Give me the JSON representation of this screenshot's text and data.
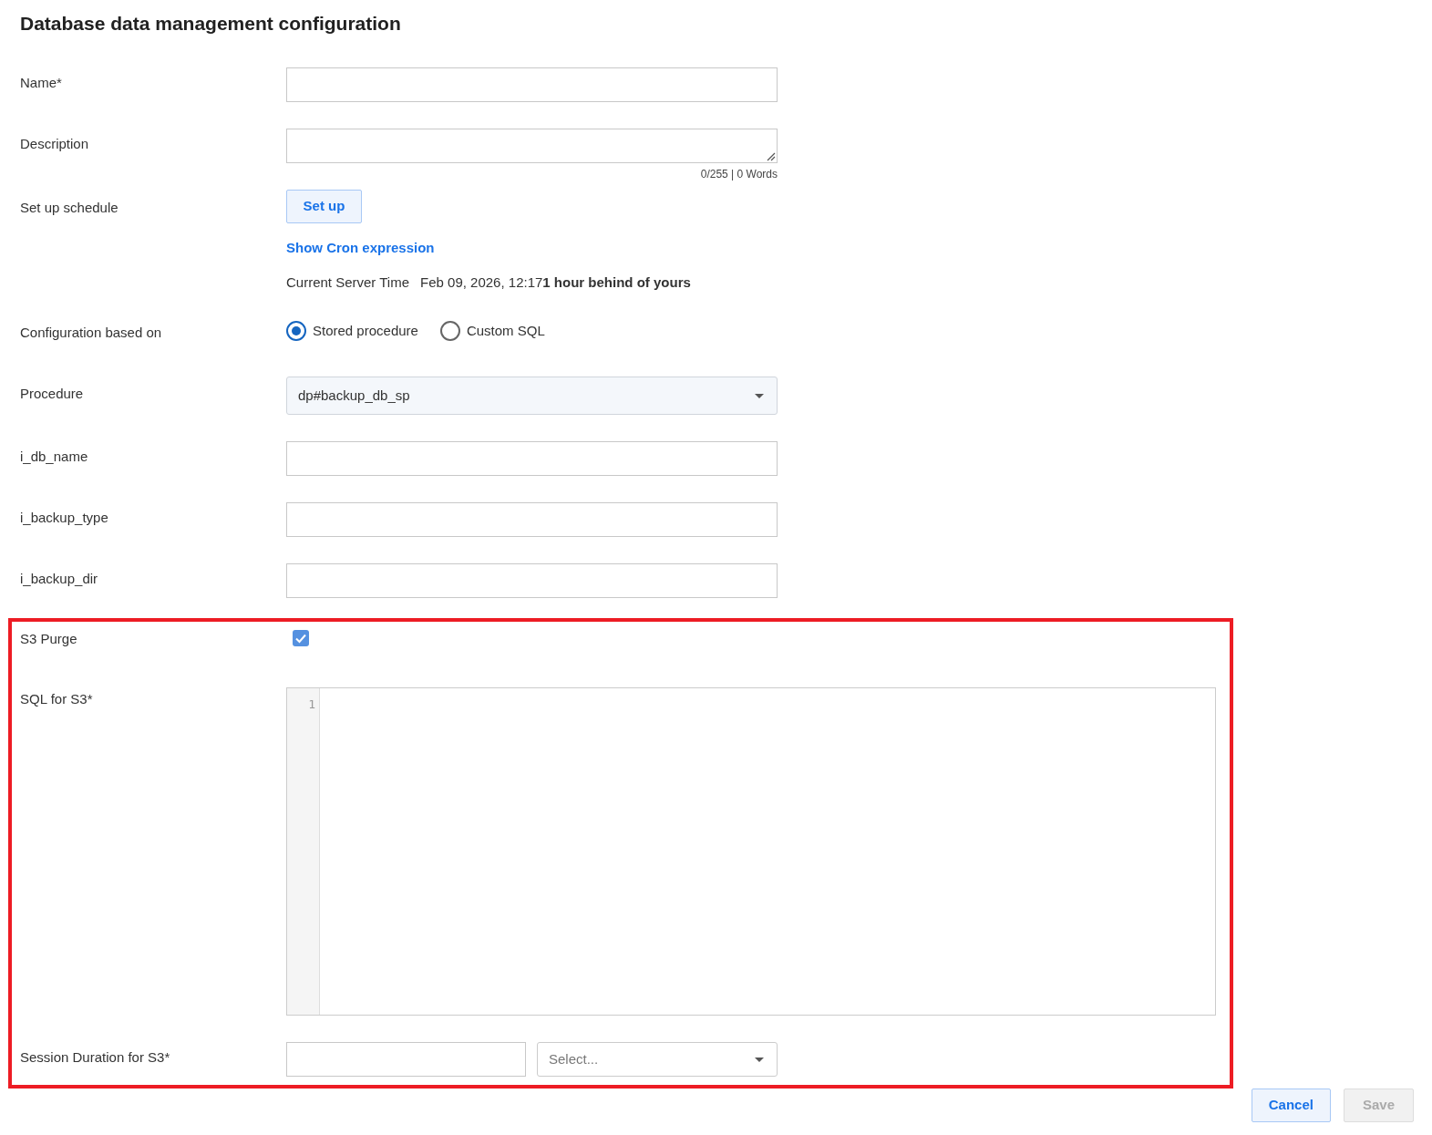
{
  "title": "Database data management configuration",
  "form": [
    {
      "kind": "text",
      "label": "Name*"
    },
    {
      "kind": "textarea",
      "label": "Description",
      "counter": "0/255 | 0 Words"
    },
    {
      "kind": "schedule",
      "label": "Set up schedule",
      "button": "Set up",
      "link": "Show Cron expression",
      "server_time_label": "Current Server Time",
      "server_time": "Feb 09, 2026, 12:17**1 hour behind of yours**"
    },
    {
      "kind": "radio",
      "label": "Configuration based on",
      "options": [
        {
          "label": "Stored procedure",
          "selected": true
        },
        {
          "label": "Custom SQL",
          "selected": false
        }
      ]
    },
    {
      "kind": "select",
      "label": "Procedure",
      "value": "dp#backup_db_sp"
    },
    {
      "kind": "text",
      "label": "i_db_name"
    },
    {
      "kind": "text",
      "label": "i_backup_type"
    },
    {
      "kind": "text",
      "label": "i_backup_dir"
    }
  ],
  "highlighted_section": {
    "highlighted": true,
    "rows": [
      {
        "kind": "checkbox",
        "label": "S3 Purge",
        "checked": true
      },
      {
        "kind": "code",
        "label": "SQL for S3*",
        "line_numbers": [
          "1"
        ]
      },
      {
        "kind": "duration",
        "label": "Session Duration for S3*",
        "placeholder": "Select..."
      }
    ]
  },
  "buttons": [
    {
      "label": "Cancel",
      "disabled": false
    },
    {
      "label": "Save",
      "disabled": true
    }
  ]
}
